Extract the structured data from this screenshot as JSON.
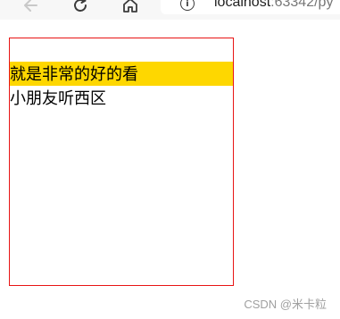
{
  "browser": {
    "url_host": "localhost",
    "url_rest": ":63342/py"
  },
  "content": {
    "line1": "就是非常的好的看",
    "line2": "小朋友听西区"
  },
  "watermark": "CSDN @米卡粒",
  "colors": {
    "highlight": "#fed700",
    "box_border": "#e81414"
  }
}
